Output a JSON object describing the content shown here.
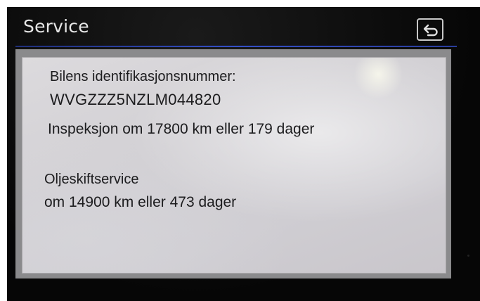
{
  "header": {
    "title": "Service"
  },
  "icons": {
    "back": "back-arrow-icon"
  },
  "panel": {
    "vin_label": "Bilens identifikasjonsnummer:",
    "vin_value": "WVGZZZ5NZLM044820",
    "inspection_text": "Inspeksjon om 17800 km eller 179 dager",
    "oil_service_title": "Oljeskiftservice",
    "oil_service_text": "om 14900 km eller 473 dager"
  },
  "colors": {
    "header_line": "#3550c8",
    "screen_background": "#050505",
    "panel_background": "#d4d2d6",
    "title_text": "#e6e6e6"
  }
}
